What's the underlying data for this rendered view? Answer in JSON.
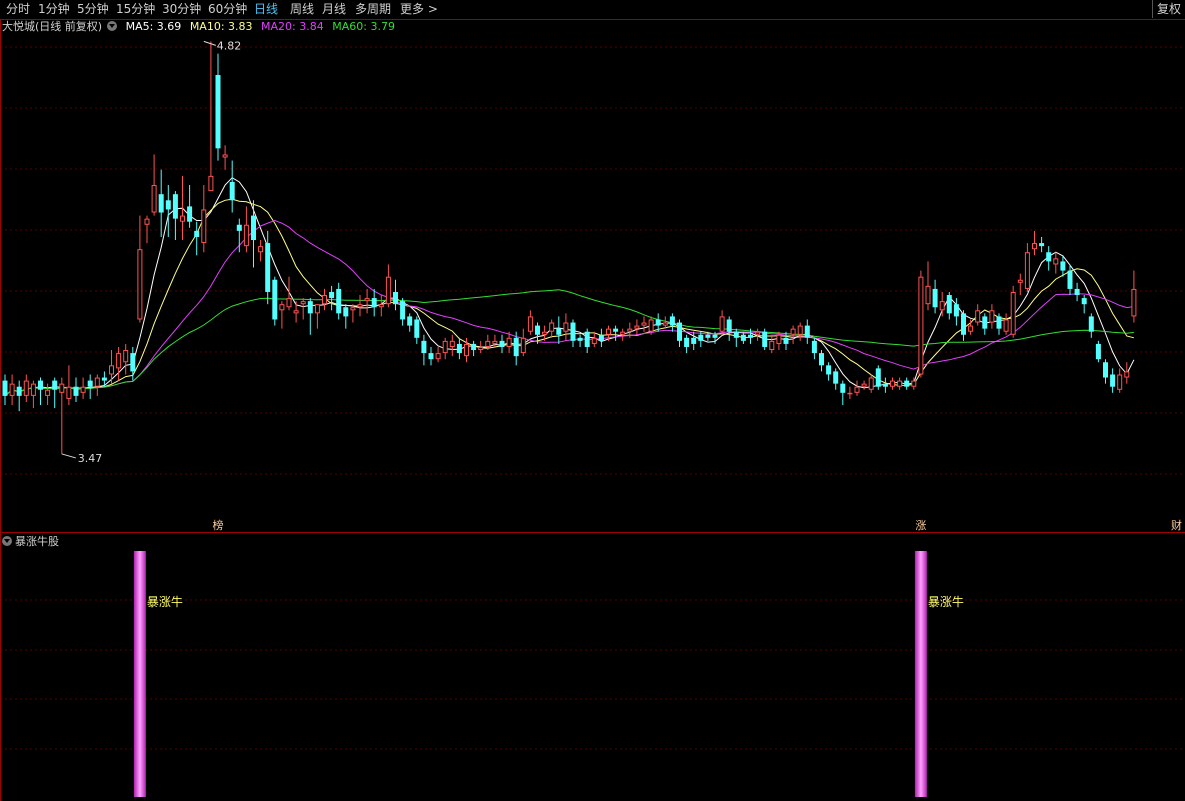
{
  "toolbar": {
    "tabs": [
      {
        "label": "分时",
        "active": false
      },
      {
        "label": "1分钟",
        "active": false
      },
      {
        "label": "5分钟",
        "active": false
      },
      {
        "label": "15分钟",
        "active": false
      },
      {
        "label": "30分钟",
        "active": false
      },
      {
        "label": "60分钟",
        "active": false
      },
      {
        "label": "日线",
        "active": true
      },
      {
        "label": "周线",
        "active": false
      },
      {
        "label": "月线",
        "active": false
      },
      {
        "label": "多周期",
        "active": false
      },
      {
        "label": "更多 >",
        "active": false
      }
    ],
    "fuquan_label": "复权"
  },
  "legend": {
    "stock": "大悦城(日线 前复权)",
    "ma5": "MA5: 3.69",
    "ma10": "MA10: 3.83",
    "ma20": "MA20: 3.84",
    "ma60": "MA60: 3.79"
  },
  "colors": {
    "up": "#ff5252",
    "down": "#54ffff",
    "ma5": "#ffffff",
    "ma10": "#ffff8a",
    "ma20": "#e040fb",
    "ma60": "#33dd33",
    "grid": "#5a0000",
    "border": "#a00000",
    "signal": "#ff66ff",
    "signal_text": "#ffff66",
    "event_text": "#ffcc99"
  },
  "indicator": {
    "title": "暴涨牛股",
    "signals": [
      {
        "index": 19,
        "label": "暴涨牛"
      },
      {
        "index": 129,
        "label": "暴涨牛"
      }
    ]
  },
  "events": [
    {
      "index": 30,
      "label": "榜"
    },
    {
      "index": 129,
      "label": "涨"
    },
    {
      "index": 165,
      "label": "财"
    }
  ],
  "chart_data": {
    "type": "candlestick",
    "ylim": [
      3.28,
      4.89
    ],
    "max_label": {
      "index": 28,
      "value": "4.82"
    },
    "min_label": {
      "index": 8,
      "value": "3.47"
    },
    "ohlc": [
      [
        3.71,
        3.66,
        3.73,
        3.63
      ],
      [
        3.66,
        3.7,
        3.73,
        3.63
      ],
      [
        3.69,
        3.66,
        3.71,
        3.61
      ],
      [
        3.66,
        3.71,
        3.73,
        3.64
      ],
      [
        3.66,
        3.7,
        3.71,
        3.62
      ],
      [
        3.71,
        3.68,
        3.72,
        3.63
      ],
      [
        3.66,
        3.68,
        3.7,
        3.63
      ],
      [
        3.71,
        3.68,
        3.72,
        3.62
      ],
      [
        3.67,
        3.7,
        3.72,
        3.47
      ],
      [
        3.65,
        3.69,
        3.76,
        3.63
      ],
      [
        3.69,
        3.66,
        3.72,
        3.64
      ],
      [
        3.67,
        3.69,
        3.72,
        3.65
      ],
      [
        3.71,
        3.69,
        3.73,
        3.65
      ],
      [
        3.69,
        3.72,
        3.73,
        3.66
      ],
      [
        3.72,
        3.71,
        3.74,
        3.69
      ],
      [
        3.73,
        3.76,
        3.81,
        3.7
      ],
      [
        3.75,
        3.8,
        3.82,
        3.71
      ],
      [
        3.77,
        3.81,
        3.83,
        3.73
      ],
      [
        3.8,
        3.74,
        3.82,
        3.71
      ],
      [
        3.91,
        4.14,
        4.25,
        3.9
      ],
      [
        4.22,
        4.24,
        4.25,
        4.16
      ],
      [
        4.26,
        4.35,
        4.45,
        4.25
      ],
      [
        4.32,
        4.26,
        4.4,
        4.18
      ],
      [
        4.3,
        4.27,
        4.35,
        4.18
      ],
      [
        4.32,
        4.24,
        4.33,
        4.17
      ],
      [
        4.23,
        4.25,
        4.38,
        4.17
      ],
      [
        4.28,
        4.23,
        4.35,
        4.21
      ],
      [
        4.2,
        4.18,
        4.23,
        4.12
      ],
      [
        4.16,
        4.27,
        4.35,
        4.13
      ],
      [
        4.33,
        4.38,
        4.82,
        4.34
      ],
      [
        4.71,
        4.47,
        4.78,
        4.43
      ],
      [
        4.44,
        4.45,
        4.48,
        4.4
      ],
      [
        4.36,
        4.3,
        4.43,
        4.26
      ],
      [
        4.22,
        4.2,
        4.24,
        4.13
      ],
      [
        4.15,
        4.22,
        4.28,
        4.13
      ],
      [
        4.25,
        4.17,
        4.3,
        4.08
      ],
      [
        4.13,
        4.15,
        4.17,
        4.1
      ],
      [
        4.16,
        4.0,
        4.2,
        3.96
      ],
      [
        4.04,
        3.91,
        4.05,
        3.89
      ],
      [
        3.94,
        3.96,
        3.97,
        3.88
      ],
      [
        3.95,
        3.98,
        4.05,
        3.94
      ],
      [
        3.93,
        3.94,
        3.97,
        3.9
      ],
      [
        3.96,
        3.97,
        3.98,
        3.91
      ],
      [
        3.97,
        3.93,
        3.98,
        3.86
      ],
      [
        3.93,
        3.96,
        3.96,
        3.88
      ],
      [
        3.96,
        3.99,
        4.01,
        3.94
      ],
      [
        4.0,
        3.98,
        4.02,
        3.94
      ],
      [
        4.01,
        3.93,
        4.03,
        3.91
      ],
      [
        3.95,
        3.92,
        3.96,
        3.88
      ],
      [
        3.94,
        3.95,
        3.96,
        3.9
      ],
      [
        3.95,
        3.96,
        3.99,
        3.92
      ],
      [
        3.97,
        3.98,
        4.01,
        3.93
      ],
      [
        3.98,
        3.95,
        4.01,
        3.92
      ],
      [
        3.95,
        3.96,
        3.99,
        3.92
      ],
      [
        3.96,
        4.05,
        4.09,
        3.95
      ],
      [
        4.0,
        3.96,
        4.04,
        3.94
      ],
      [
        3.97,
        3.91,
        3.98,
        3.89
      ],
      [
        3.92,
        3.89,
        3.93,
        3.87
      ],
      [
        3.91,
        3.85,
        3.92,
        3.83
      ],
      [
        3.84,
        3.8,
        3.86,
        3.76
      ],
      [
        3.8,
        3.78,
        3.82,
        3.76
      ],
      [
        3.78,
        3.8,
        3.82,
        3.77
      ],
      [
        3.8,
        3.84,
        3.85,
        3.78
      ],
      [
        3.82,
        3.84,
        3.86,
        3.79
      ],
      [
        3.83,
        3.8,
        3.85,
        3.78
      ],
      [
        3.79,
        3.83,
        3.85,
        3.77
      ],
      [
        3.83,
        3.81,
        3.84,
        3.79
      ],
      [
        3.81,
        3.82,
        3.84,
        3.8
      ],
      [
        3.82,
        3.84,
        3.86,
        3.81
      ],
      [
        3.83,
        3.84,
        3.86,
        3.82
      ],
      [
        3.84,
        3.82,
        3.86,
        3.8
      ],
      [
        3.82,
        3.85,
        3.87,
        3.8
      ],
      [
        3.85,
        3.79,
        3.87,
        3.76
      ],
      [
        3.8,
        3.85,
        3.88,
        3.79
      ],
      [
        3.87,
        3.92,
        3.94,
        3.86
      ],
      [
        3.89,
        3.86,
        3.9,
        3.83
      ],
      [
        3.86,
        3.87,
        3.89,
        3.84
      ],
      [
        3.87,
        3.9,
        3.91,
        3.85
      ],
      [
        3.88,
        3.86,
        3.92,
        3.83
      ],
      [
        3.87,
        3.9,
        3.93,
        3.84
      ],
      [
        3.9,
        3.84,
        3.91,
        3.82
      ],
      [
        3.85,
        3.84,
        3.86,
        3.82
      ],
      [
        3.87,
        3.82,
        3.88,
        3.8
      ],
      [
        3.83,
        3.85,
        3.87,
        3.82
      ],
      [
        3.86,
        3.84,
        3.88,
        3.82
      ],
      [
        3.86,
        3.88,
        3.89,
        3.84
      ],
      [
        3.88,
        3.87,
        3.89,
        3.84
      ],
      [
        3.86,
        3.87,
        3.88,
        3.84
      ],
      [
        3.87,
        3.88,
        3.9,
        3.85
      ],
      [
        3.88,
        3.89,
        3.91,
        3.86
      ],
      [
        3.89,
        3.9,
        3.92,
        3.87
      ],
      [
        3.87,
        3.91,
        3.92,
        3.86
      ],
      [
        3.91,
        3.89,
        3.93,
        3.87
      ],
      [
        3.89,
        3.9,
        3.92,
        3.88
      ],
      [
        3.92,
        3.89,
        3.93,
        3.87
      ],
      [
        3.9,
        3.84,
        3.91,
        3.82
      ],
      [
        3.85,
        3.82,
        3.86,
        3.8
      ],
      [
        3.85,
        3.83,
        3.87,
        3.81
      ],
      [
        3.86,
        3.84,
        3.87,
        3.82
      ],
      [
        3.86,
        3.85,
        3.87,
        3.84
      ],
      [
        3.86,
        3.85,
        3.87,
        3.83
      ],
      [
        3.87,
        3.92,
        3.94,
        3.86
      ],
      [
        3.91,
        3.87,
        3.92,
        3.84
      ],
      [
        3.87,
        3.85,
        3.88,
        3.82
      ],
      [
        3.86,
        3.84,
        3.87,
        3.83
      ],
      [
        3.86,
        3.85,
        3.88,
        3.83
      ],
      [
        3.86,
        3.87,
        3.88,
        3.84
      ],
      [
        3.87,
        3.82,
        3.88,
        3.81
      ],
      [
        3.81,
        3.84,
        3.86,
        3.8
      ],
      [
        3.83,
        3.86,
        3.87,
        3.81
      ],
      [
        3.85,
        3.83,
        3.87,
        3.81
      ],
      [
        3.86,
        3.88,
        3.89,
        3.83
      ],
      [
        3.86,
        3.89,
        3.9,
        3.84
      ],
      [
        3.89,
        3.85,
        3.91,
        3.83
      ],
      [
        3.84,
        3.8,
        3.85,
        3.78
      ],
      [
        3.8,
        3.76,
        3.81,
        3.74
      ],
      [
        3.76,
        3.73,
        3.77,
        3.71
      ],
      [
        3.74,
        3.7,
        3.75,
        3.68
      ],
      [
        3.7,
        3.67,
        3.71,
        3.63
      ],
      [
        3.67,
        3.67,
        3.69,
        3.65
      ],
      [
        3.67,
        3.69,
        3.71,
        3.66
      ],
      [
        3.69,
        3.7,
        3.71,
        3.68
      ],
      [
        3.68,
        3.72,
        3.73,
        3.67
      ],
      [
        3.75,
        3.69,
        3.76,
        3.68
      ],
      [
        3.7,
        3.69,
        3.72,
        3.67
      ],
      [
        3.69,
        3.71,
        3.72,
        3.68
      ],
      [
        3.69,
        3.71,
        3.72,
        3.68
      ],
      [
        3.71,
        3.69,
        3.72,
        3.68
      ],
      [
        3.69,
        3.71,
        3.72,
        3.68
      ],
      [
        3.73,
        4.05,
        4.07,
        3.72
      ],
      [
        3.96,
        4.02,
        4.1,
        3.94
      ],
      [
        4.01,
        3.95,
        4.04,
        3.93
      ],
      [
        3.94,
        3.97,
        4.0,
        3.92
      ],
      [
        3.99,
        3.93,
        4.0,
        3.91
      ],
      [
        3.96,
        3.92,
        3.98,
        3.89
      ],
      [
        3.93,
        3.86,
        3.94,
        3.84
      ],
      [
        3.87,
        3.89,
        3.91,
        3.86
      ],
      [
        3.9,
        3.94,
        3.96,
        3.89
      ],
      [
        3.92,
        3.88,
        3.93,
        3.86
      ],
      [
        3.9,
        3.94,
        3.96,
        3.88
      ],
      [
        3.92,
        3.88,
        3.93,
        3.86
      ],
      [
        3.87,
        3.91,
        3.93,
        3.86
      ],
      [
        3.86,
        4.0,
        4.02,
        3.85
      ],
      [
        4.03,
        4.04,
        4.06,
        3.99
      ],
      [
        4.01,
        4.13,
        4.16,
        4.0
      ],
      [
        4.14,
        4.16,
        4.2,
        4.12
      ],
      [
        4.16,
        4.15,
        4.18,
        4.13
      ],
      [
        4.13,
        4.1,
        4.15,
        4.07
      ],
      [
        4.09,
        4.11,
        4.13,
        4.06
      ],
      [
        4.1,
        4.07,
        4.12,
        4.05
      ],
      [
        4.07,
        4.01,
        4.09,
        3.99
      ],
      [
        4.01,
        3.99,
        4.03,
        3.97
      ],
      [
        3.98,
        3.96,
        3.99,
        3.93
      ],
      [
        3.92,
        3.87,
        3.93,
        3.85
      ],
      [
        3.83,
        3.78,
        3.84,
        3.77
      ],
      [
        3.77,
        3.72,
        3.78,
        3.7
      ],
      [
        3.73,
        3.69,
        3.75,
        3.67
      ],
      [
        3.68,
        3.73,
        3.75,
        3.67
      ],
      [
        3.72,
        3.74,
        3.77,
        3.7
      ],
      [
        3.92,
        4.01,
        4.07,
        3.9
      ]
    ]
  }
}
